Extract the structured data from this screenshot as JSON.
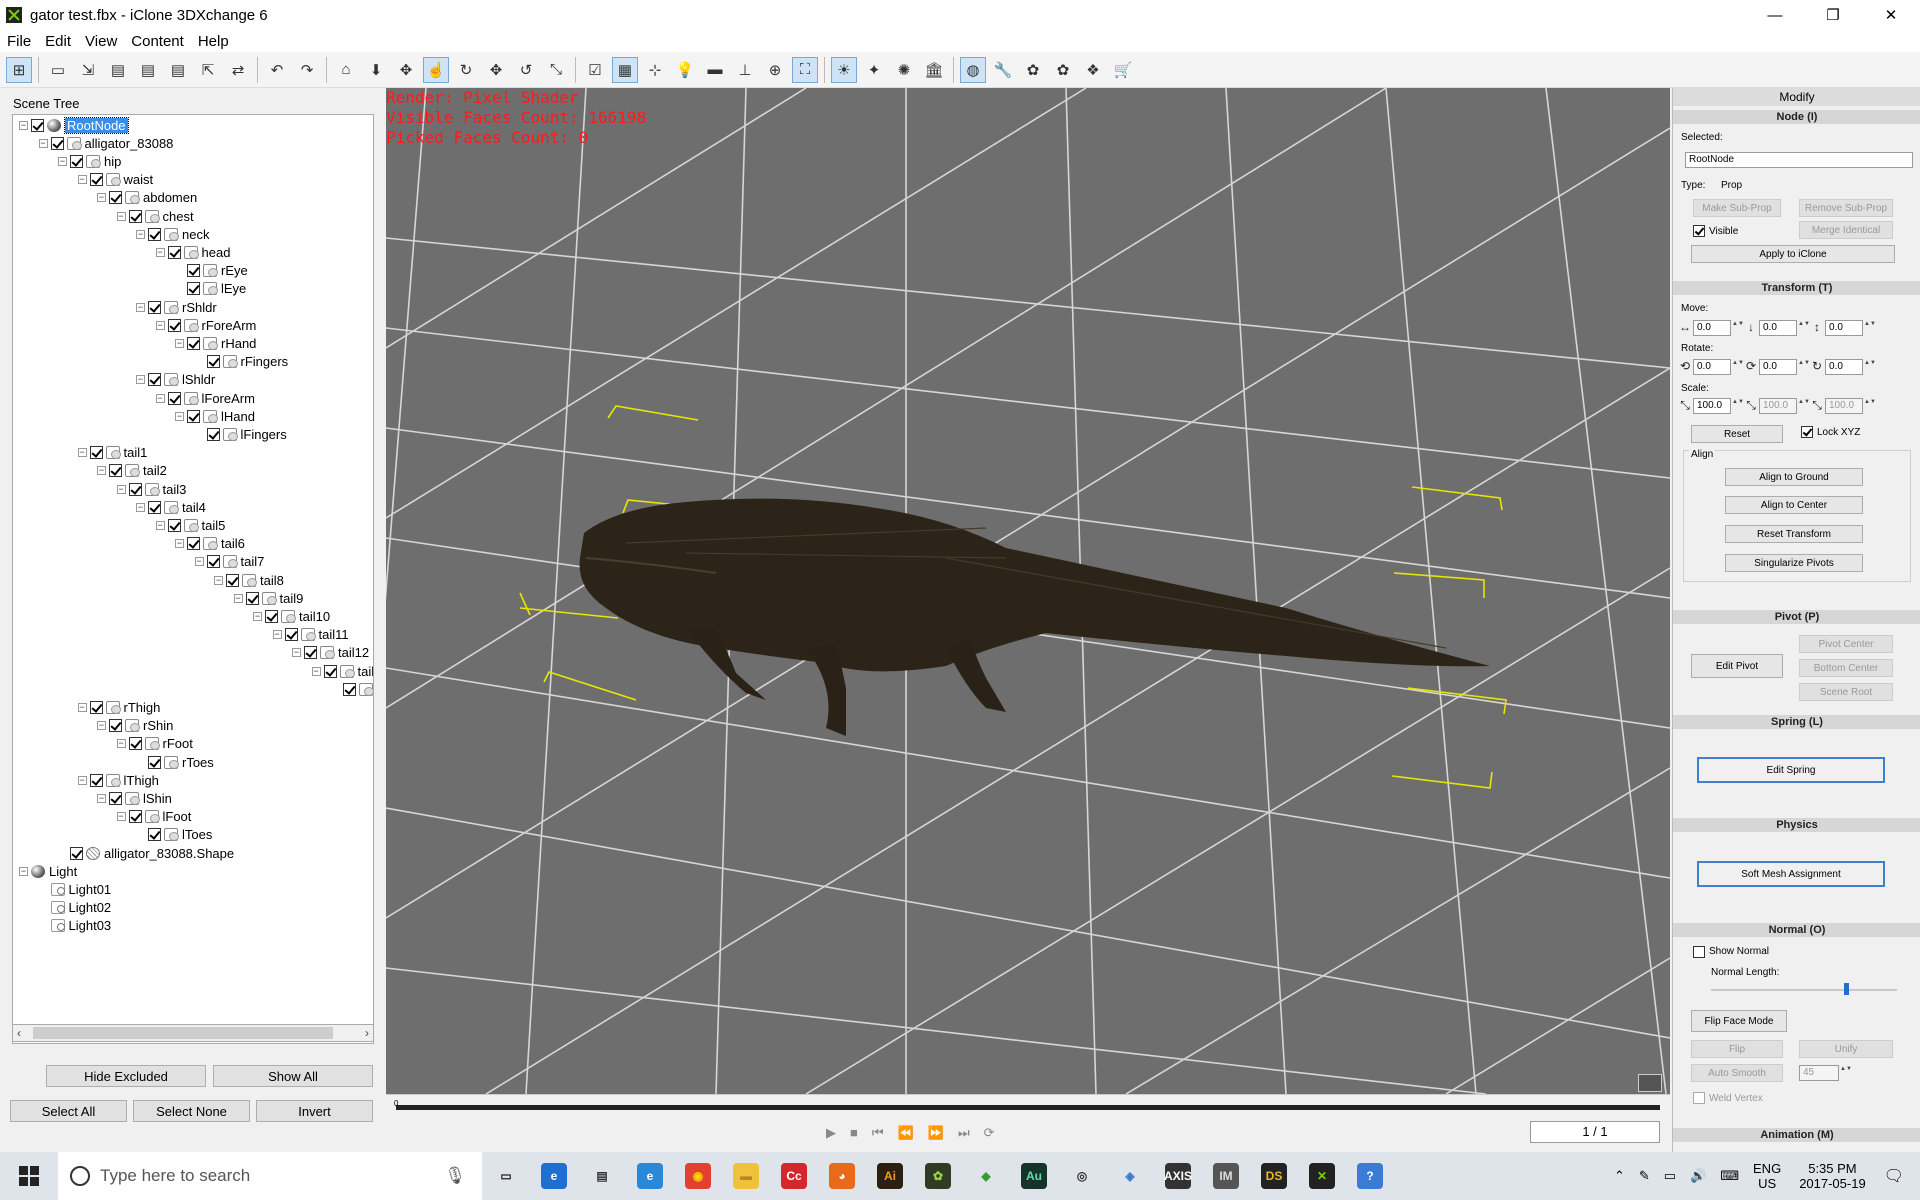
{
  "window": {
    "title": "gator test.fbx - iClone 3DXchange 6",
    "minimize": "—",
    "maximize": "❐",
    "close": "✕"
  },
  "menu": [
    "File",
    "Edit",
    "View",
    "Content",
    "Help"
  ],
  "toolbar_icons": [
    "scene-tree-icon",
    "open-icon",
    "import-icon",
    "import-fbx-icon",
    "import-bvh-icon",
    "import-obj-icon",
    "export-icon",
    "convert-icon",
    "undo-icon",
    "redo-icon",
    "home-icon",
    "move-down-icon",
    "move-icon",
    "pick-icon",
    "rotate-icon",
    "transform-icon",
    "reset-icon",
    "scale-icon",
    "checkbox-icon",
    "grid-icon",
    "axis-icon",
    "light-bulb-icon",
    "box-icon",
    "ground-icon",
    "globe-icon",
    "camera-fit-icon",
    "sun-icon",
    "star-icon",
    "spotlight-icon",
    "museum-icon",
    "sphere-icon",
    "wrench-icon",
    "effect-icon",
    "effect2-icon",
    "morph-icon",
    "cart-icon"
  ],
  "scene_tree": {
    "title": "Scene Tree",
    "root": "RootNode",
    "nodes": [
      "alligator_83088",
      "hip",
      "waist",
      "abdomen",
      "chest",
      "neck",
      "head",
      "rEye",
      "lEye",
      "rShldr",
      "rForeArm",
      "rHand",
      "rFingers",
      "lShldr",
      "lForeArm",
      "lHand",
      "lFingers",
      "tail1",
      "tail2",
      "tail3",
      "tail4",
      "tail5",
      "tail6",
      "tail7",
      "tail8",
      "tail9",
      "tail10",
      "tail11",
      "tail12",
      "tail",
      "",
      "rThigh",
      "rShin",
      "rFoot",
      "rToes",
      "lThigh",
      "lShin",
      "lFoot",
      "lToes",
      "alligator_83088.Shape",
      "Light",
      "Light01",
      "Light02",
      "Light03"
    ],
    "buttons": {
      "hide_excluded": "Hide Excluded",
      "show_all": "Show All",
      "select_all": "Select All",
      "select_none": "Select None",
      "invert": "Invert"
    }
  },
  "viewport": {
    "render": "Render: Pixel Shader",
    "faces": "Visible Faces Count: 166198",
    "picked": "Picked Faces Count: 0"
  },
  "timeline": {
    "frame": "1 / 1",
    "start_marker": "0"
  },
  "modify": {
    "title": "Modify",
    "node": {
      "header": "Node (I)",
      "selected_label": "Selected:",
      "selected_value": "RootNode",
      "type_label": "Type:",
      "type_value": "Prop",
      "make_sub": "Make Sub-Prop",
      "remove_sub": "Remove Sub-Prop",
      "visible": "Visible",
      "merge": "Merge Identical",
      "apply": "Apply to iClone"
    },
    "transform": {
      "header": "Transform (T)",
      "move_label": "Move:",
      "rotate_label": "Rotate:",
      "scale_label": "Scale:",
      "move": [
        "0.0",
        "0.0",
        "0.0"
      ],
      "rotate": [
        "0.0",
        "0.0",
        "0.0"
      ],
      "scale": [
        "100.0",
        "100.0",
        "100.0"
      ],
      "reset": "Reset",
      "lock": "Lock XYZ",
      "align": "Align",
      "align_ground": "Align to Ground",
      "align_center": "Align to Center",
      "reset_transform": "Reset Transform",
      "singularize": "Singularize Pivots"
    },
    "pivot": {
      "header": "Pivot (P)",
      "edit": "Edit Pivot",
      "center": "Pivot Center",
      "bottom": "Bottom Center",
      "scene_root": "Scene Root"
    },
    "spring": {
      "header": "Spring (L)",
      "edit": "Edit Spring"
    },
    "physics": {
      "header": "Physics",
      "soft": "Soft Mesh Assignment"
    },
    "normal": {
      "header": "Normal (O)",
      "show": "Show Normal",
      "length": "Normal Length:",
      "flip_face": "Flip Face Mode",
      "flip": "Flip",
      "unify": "Unify",
      "auto_smooth": "Auto Smooth",
      "smooth_value": "45",
      "weld": "Weld Vertex"
    },
    "animation": {
      "header": "Animation (M)"
    }
  },
  "taskbar": {
    "search_placeholder": "Type here to search",
    "apps": [
      {
        "name": "task-view-icon",
        "label": "▭",
        "color": "#dfe3ea",
        "fg": "#222"
      },
      {
        "name": "edge-icon",
        "label": "e",
        "color": "#1e6fd0",
        "fg": "#fff"
      },
      {
        "name": "store-icon",
        "label": "▤",
        "color": "#dfe3ea",
        "fg": "#333"
      },
      {
        "name": "ie-icon",
        "label": "e",
        "color": "#2a88d8",
        "fg": "#fff"
      },
      {
        "name": "chrome-icon",
        "label": "◉",
        "color": "#e4402f",
        "fg": "#ffd100"
      },
      {
        "name": "explorer-icon",
        "label": "▬",
        "color": "#f2c13c",
        "fg": "#b7852a"
      },
      {
        "name": "creative-cloud-icon",
        "label": "Cc",
        "color": "#d4272b",
        "fg": "#fff"
      },
      {
        "name": "firefox-icon",
        "label": "◕",
        "color": "#e86b1c",
        "fg": "#fff"
      },
      {
        "name": "illustrator-icon",
        "label": "Ai",
        "color": "#2d1f0f",
        "fg": "#f7961d"
      },
      {
        "name": "app-green-icon",
        "label": "✿",
        "color": "#2f3b23",
        "fg": "#9fd04a"
      },
      {
        "name": "app-leaf-icon",
        "label": "◆",
        "color": "#dfe3ea",
        "fg": "#3a9a3a"
      },
      {
        "name": "audition-icon",
        "label": "Au",
        "color": "#15332a",
        "fg": "#56e0a6"
      },
      {
        "name": "obs-icon",
        "label": "◎",
        "color": "#dfe3ea",
        "fg": "#333"
      },
      {
        "name": "cube-icon",
        "label": "◈",
        "color": "#dfe3ea",
        "fg": "#3d78c8"
      },
      {
        "name": "axis-icon",
        "label": "AXIS",
        "color": "#333",
        "fg": "#fff"
      },
      {
        "name": "im-icon",
        "label": "IM",
        "color": "#555",
        "fg": "#ddd"
      },
      {
        "name": "daz-icon",
        "label": "DS",
        "color": "#222",
        "fg": "#e9b52f"
      },
      {
        "name": "3dxchange-icon",
        "label": "✕",
        "color": "#222",
        "fg": "#7bd000"
      },
      {
        "name": "help-icon",
        "label": "?",
        "color": "#3a7bd5",
        "fg": "#fff"
      }
    ],
    "lang": "ENG",
    "region": "US",
    "time": "5:35 PM",
    "date": "2017-05-19"
  }
}
